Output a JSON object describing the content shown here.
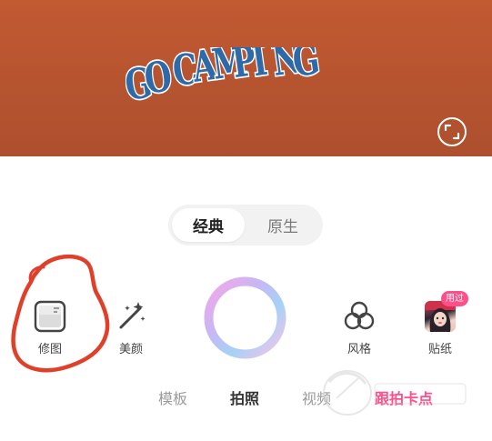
{
  "banner": {
    "title": "GO CAMPING",
    "title_color": "#2f6aa8",
    "background_color": "#b9562f"
  },
  "toggle": {
    "options": [
      {
        "label": "经典",
        "selected": true
      },
      {
        "label": "原生",
        "selected": false
      }
    ]
  },
  "tools_left": [
    {
      "label": "修图",
      "icon": "photo-edit-icon"
    },
    {
      "label": "美颜",
      "icon": "magic-wand-icon"
    }
  ],
  "tools_right": [
    {
      "label": "风格",
      "icon": "style-circles-icon"
    },
    {
      "label": "贴纸",
      "icon": "sticker-thumbnail",
      "badge": "用过"
    }
  ],
  "modes": [
    {
      "label": "模板",
      "state": "idle"
    },
    {
      "label": "拍照",
      "state": "active"
    },
    {
      "label": "视频",
      "state": "idle"
    },
    {
      "label": "跟拍卡点",
      "state": "highlight"
    }
  ],
  "colors": {
    "accent_pink": "#ff4f8b",
    "annotation_red": "#e0402a"
  }
}
